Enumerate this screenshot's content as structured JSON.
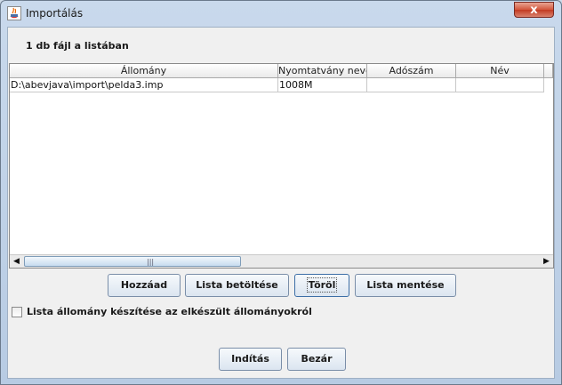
{
  "window": {
    "title": "Importálás",
    "close_label": "x"
  },
  "status": {
    "file_count_label": "1 db fájl a listában"
  },
  "table": {
    "columns": [
      "Állomány",
      "Nyomtatvány neve",
      "Adószám",
      "Név"
    ],
    "rows": [
      {
        "file": "D:\\abevjava\\import\\pelda3.imp",
        "form_name": "1008M",
        "tax_number": "",
        "name": ""
      }
    ]
  },
  "scrollbar": {
    "left_arrow": "◀",
    "right_arrow": "▶",
    "grip": "|||"
  },
  "buttons": {
    "add": "Hozzáad",
    "load_list": "Lista betöltése",
    "delete": "Töröl",
    "save_list": "Lista mentése",
    "start": "Indítás",
    "close": "Bezár"
  },
  "checkbox": {
    "label": "Lista állomány készítése az elkészült állományokról",
    "checked": false
  },
  "colors": {
    "titlebar": "#c9d9ec",
    "client_bg": "#f0f0f0",
    "close_button": "#c23a22"
  }
}
